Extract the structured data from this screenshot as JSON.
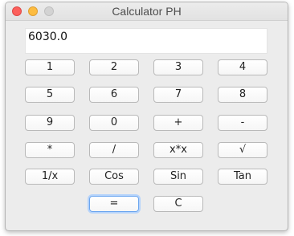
{
  "window": {
    "title": "Calculator PH"
  },
  "display": {
    "value": "6030.0"
  },
  "buttons": {
    "one": "1",
    "two": "2",
    "three": "3",
    "four": "4",
    "five": "5",
    "six": "6",
    "seven": "7",
    "eight": "8",
    "nine": "9",
    "zero": "0",
    "plus": "+",
    "minus": "-",
    "multiply": "*",
    "divide": "/",
    "square": "x*x",
    "sqrt": "√",
    "reciprocal": "1/x",
    "cos": "Cos",
    "sin": "Sin",
    "tan": "Tan",
    "equals": "=",
    "clear": "C"
  }
}
